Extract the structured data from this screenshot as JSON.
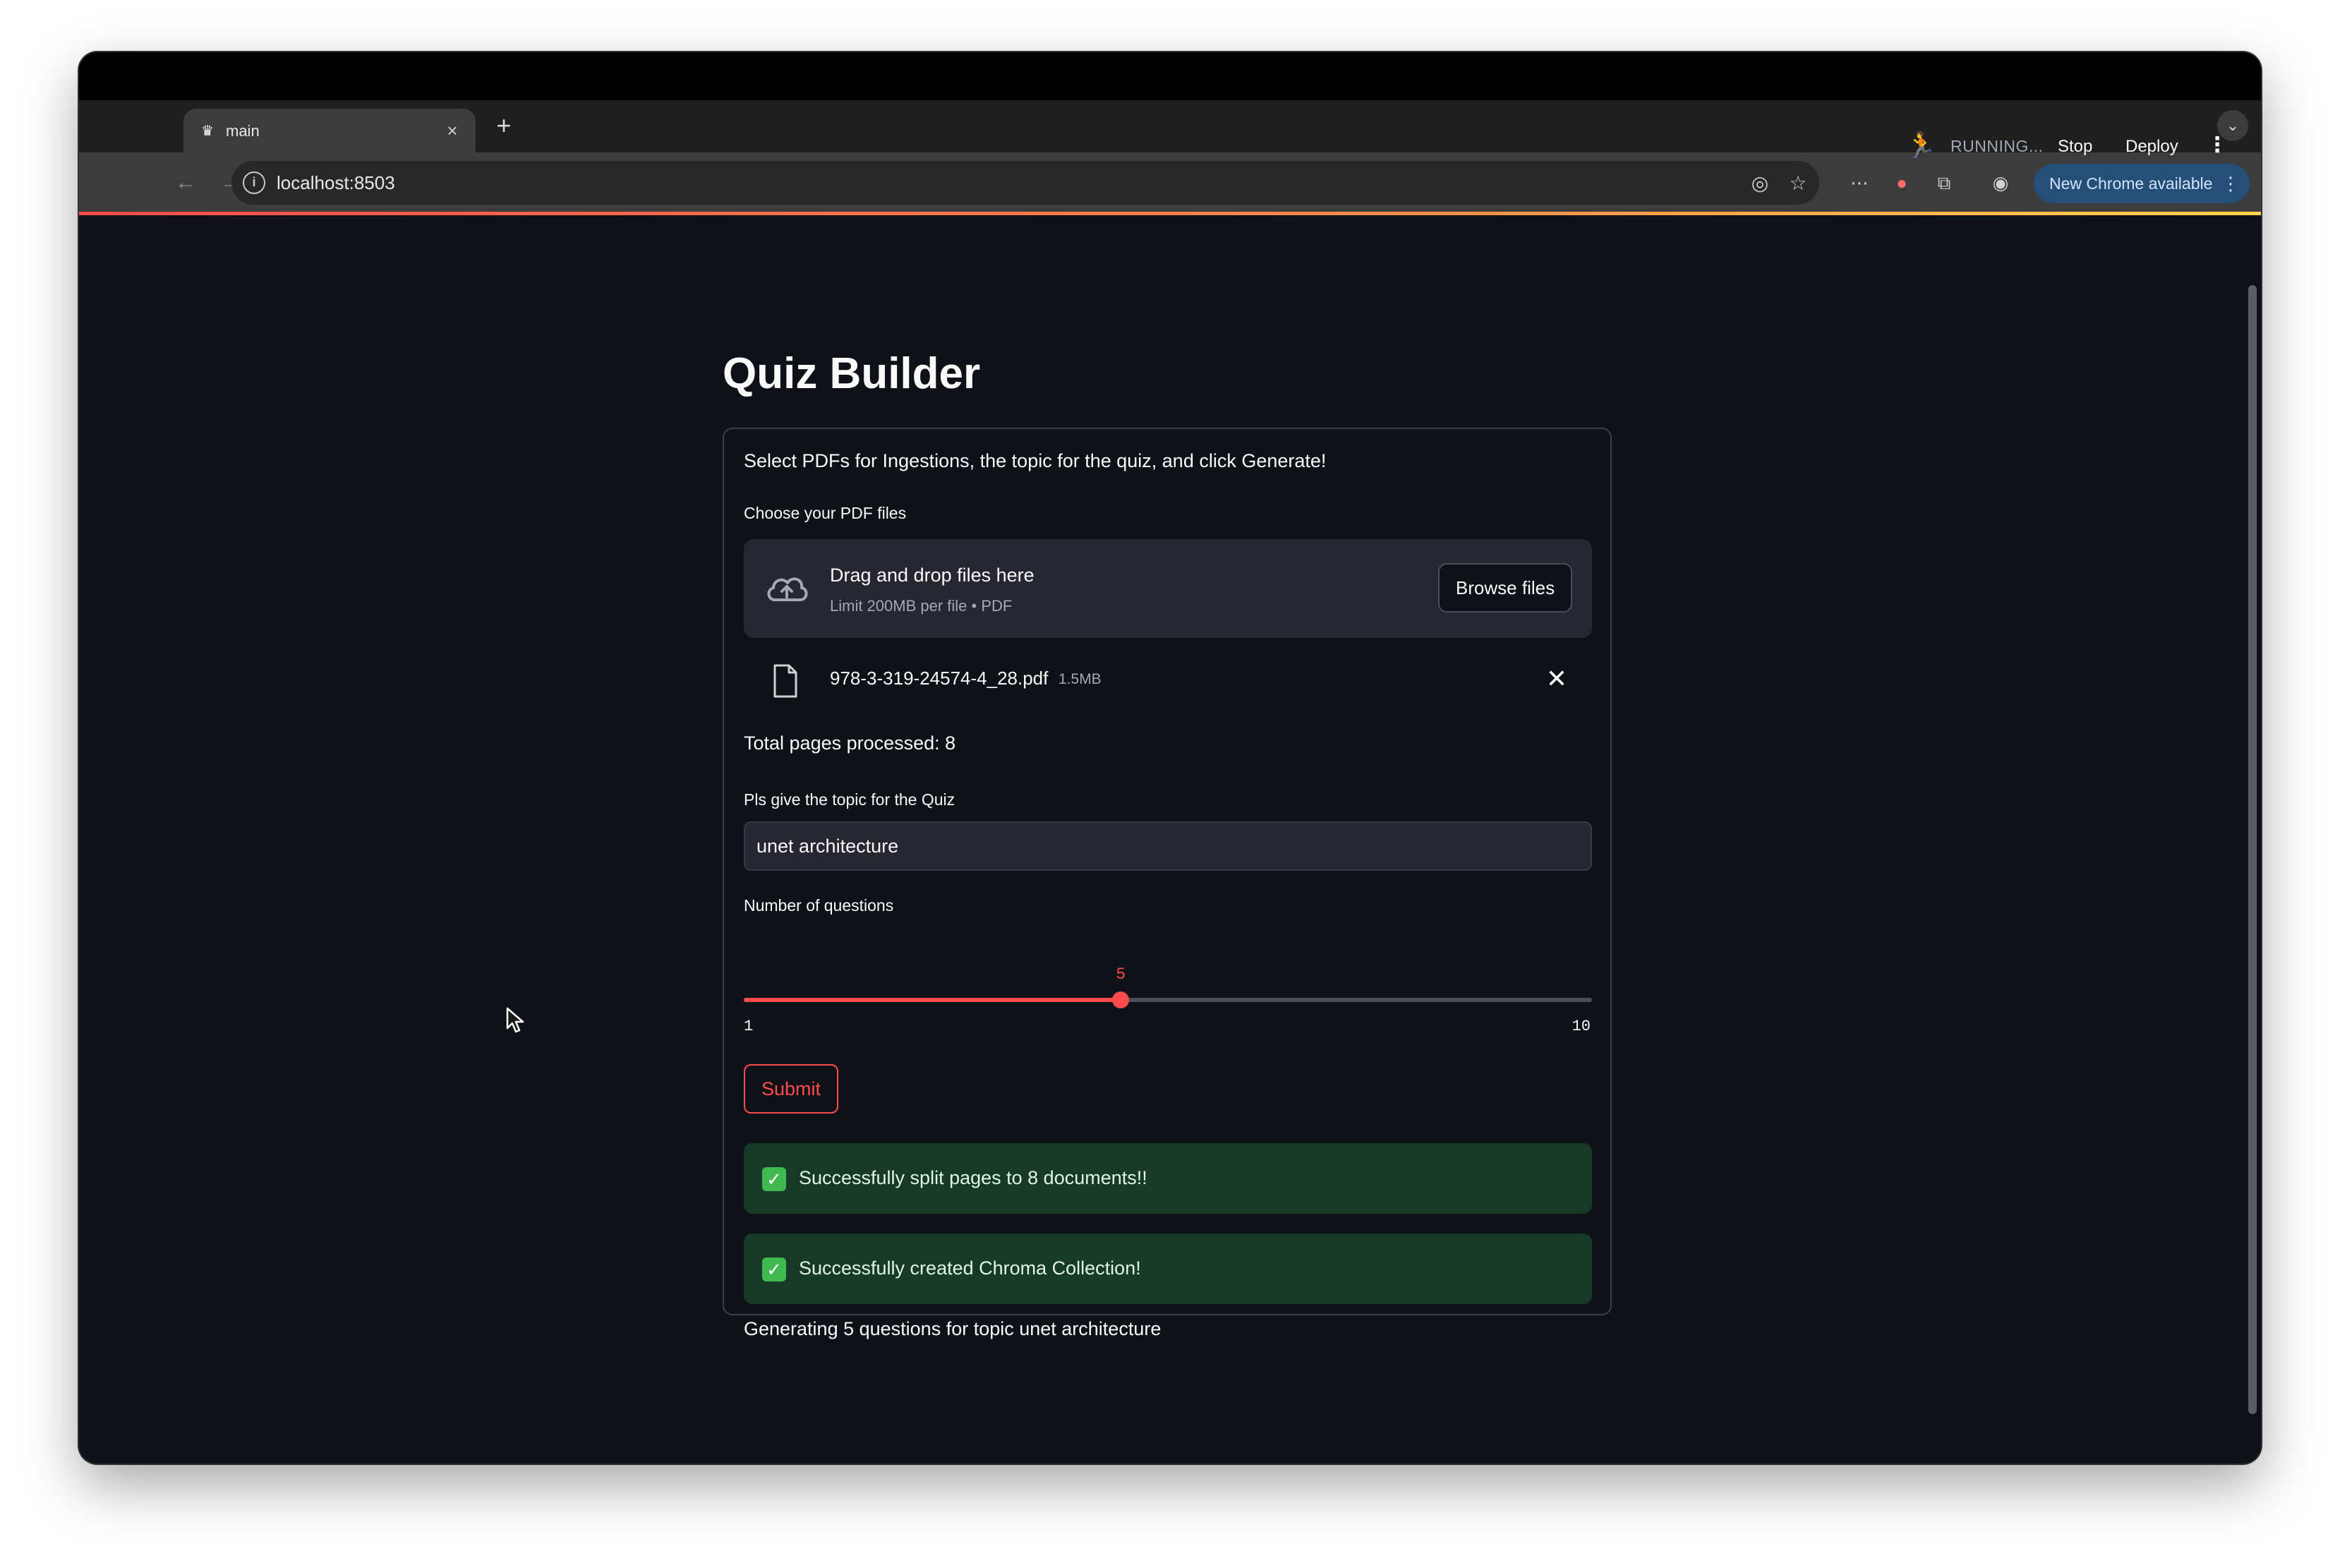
{
  "browser": {
    "tab_title": "main",
    "url": "localhost:8503",
    "update_label": "New Chrome available"
  },
  "header": {
    "status": "RUNNING...",
    "stop_label": "Stop",
    "deploy_label": "Deploy"
  },
  "page": {
    "title": "Quiz Builder",
    "intro": "Select PDFs for Ingestions, the topic for the quiz, and click Generate!"
  },
  "uploader": {
    "label": "Choose your PDF files",
    "drop_title": "Drag and drop files here",
    "drop_subtitle": "Limit 200MB per file • PDF",
    "browse_label": "Browse files",
    "file_name": "978-3-319-24574-4_28.pdf",
    "file_size": "1.5MB"
  },
  "total_pages": "Total pages processed: 8",
  "topic": {
    "label": "Pls give the topic for the Quiz",
    "value": "unet architecture"
  },
  "slider": {
    "label": "Number of questions",
    "min": 1,
    "max": 10,
    "value": 5,
    "min_label": "1",
    "max_label": "10",
    "value_label": "5"
  },
  "submit_label": "Submit",
  "alerts": [
    "Successfully split pages to 8 documents!!",
    "Successfully created Chroma Collection!"
  ],
  "generating": "Generating 5 questions for topic unet architecture",
  "colors": {
    "accent": "#ff4b4b",
    "background": "#0e1117",
    "success_bg": "#173928"
  }
}
